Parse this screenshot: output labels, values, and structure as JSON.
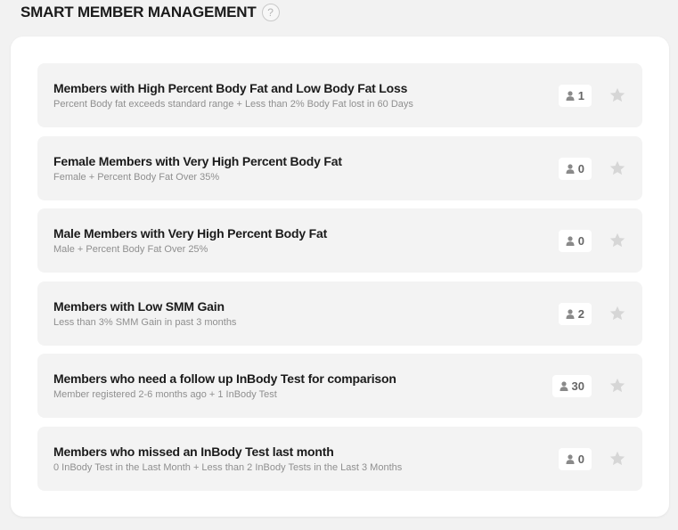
{
  "header": {
    "title": "SMART MEMBER MANAGEMENT",
    "help_icon": "?"
  },
  "icons": {
    "person": "person-icon",
    "star": "star-icon"
  },
  "colors": {
    "item_bg": "#f3f3f3",
    "star": "#d6d6d6",
    "count_text": "#666666"
  },
  "items": [
    {
      "title": "Members with High Percent Body Fat and Low Body Fat Loss",
      "subtitle": "Percent Body fat exceeds standard range + Less than 2% Body Fat lost in 60 Days",
      "count": "1"
    },
    {
      "title": "Female Members with Very High Percent Body Fat",
      "subtitle": "Female + Percent Body Fat Over 35%",
      "count": "0"
    },
    {
      "title": "Male Members with Very High Percent Body Fat",
      "subtitle": "Male + Percent Body Fat Over 25%",
      "count": "0"
    },
    {
      "title": "Members with Low SMM Gain",
      "subtitle": "Less than 3% SMM Gain in past 3 months",
      "count": "2"
    },
    {
      "title": "Members who need a follow up InBody Test for comparison",
      "subtitle": "Member registered 2-6 months ago + 1 InBody Test",
      "count": "30"
    },
    {
      "title": "Members who missed an InBody Test last month",
      "subtitle": "0 InBody Test in the Last Month + Less than 2 InBody Tests in the Last 3 Months",
      "count": "0"
    }
  ]
}
